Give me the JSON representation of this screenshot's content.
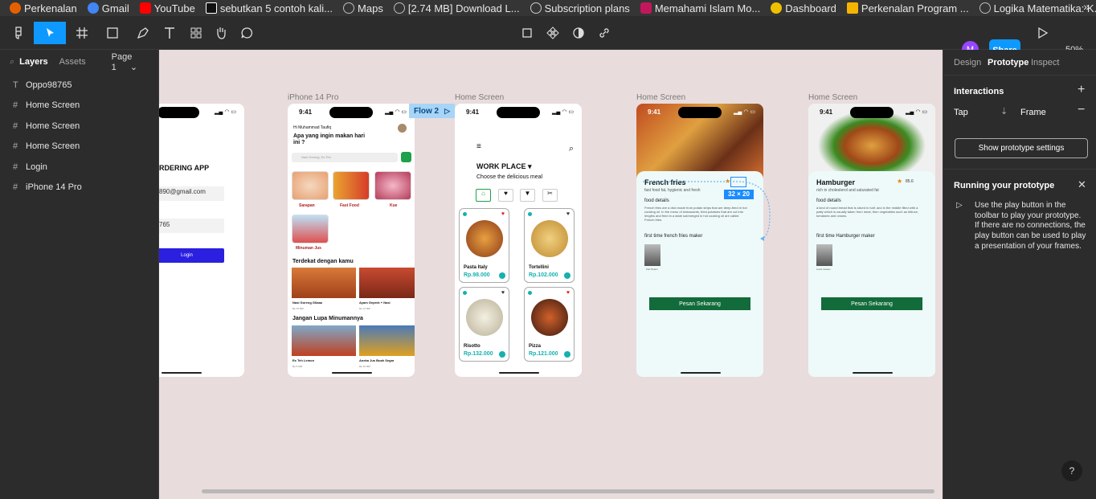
{
  "bookmarks": [
    {
      "label": "Perkenalan",
      "icon": "firefox-icon",
      "color": "#e66000"
    },
    {
      "label": "Gmail",
      "icon": "google-icon",
      "color": "#4285f4"
    },
    {
      "label": "YouTube",
      "icon": "youtube-icon",
      "color": "#ff0000"
    },
    {
      "label": "sebutkan 5 contoh kali...",
      "icon": "brainly-icon",
      "color": "#111111"
    },
    {
      "label": "Maps",
      "icon": "globe-icon",
      "color": "#888888"
    },
    {
      "label": "[2.74 MB] Download L...",
      "icon": "globe-icon",
      "color": "#888888"
    },
    {
      "label": "Subscription plans",
      "icon": "openai-icon",
      "color": "#cccccc"
    },
    {
      "label": "Memahami Islam Mo...",
      "icon": "app-icon",
      "color": "#c2185b"
    },
    {
      "label": "Dashboard",
      "icon": "dashboard-icon",
      "color": "#f0c000"
    },
    {
      "label": "Perkenalan Program ...",
      "icon": "slides-icon",
      "color": "#f5b400"
    },
    {
      "label": "Logika Matematika: K...",
      "icon": "globe-icon",
      "color": "#888888"
    }
  ],
  "toolbar": {
    "avatar_initial": "M",
    "share_label": "Share",
    "zoom": "50%"
  },
  "left": {
    "tabs": {
      "layers": "Layers",
      "assets": "Assets",
      "page": "Page 1"
    },
    "layers": [
      {
        "label": "Oppo98765",
        "icon": "T"
      },
      {
        "label": "Home Screen",
        "icon": "#"
      },
      {
        "label": "Home Screen",
        "icon": "#"
      },
      {
        "label": "Home Screen",
        "icon": "#"
      },
      {
        "label": "Login",
        "icon": "#"
      },
      {
        "label": "iPhone 14 Pro",
        "icon": "#"
      }
    ]
  },
  "canvas": {
    "frame_labels": [
      "iPhone 14 Pro",
      "Home Screen",
      "Home Screen",
      "Home Screen"
    ],
    "flow_label": "Flow 2",
    "selection_size": "32 × 20",
    "login": {
      "title": "RDERING APP",
      "email": "890@gmail.com",
      "password": "765",
      "button": "Login"
    },
    "home1": {
      "time": "9:41",
      "greeting": "Hi Muhammad Taufiq",
      "question": "Apa yang ingin makan hari ini ?",
      "search_placeholder": "Nasi Goreng, Es Teh",
      "categories": [
        "Sarapan",
        "Fast Food",
        "Kue",
        "Minuman Jus"
      ],
      "near_title": "Terdekat dengan kamu",
      "near_items": [
        "Nasi Goreng Gilaaa",
        "Ayam Geprek + Nasi"
      ],
      "near_prices": [
        "Rp 15.000",
        "Rp 12.000"
      ],
      "drink_title": "Jangan Lupa Minumannya",
      "drink_items": [
        "Es Teh Lemon",
        "Aneka Jus Buah Segar"
      ],
      "drink_prices": [
        "Rp 5.000",
        "Rp 10.000"
      ]
    },
    "home2": {
      "time": "9:41",
      "title": "WORK PLACE",
      "subtitle": "Choose the delicious meal",
      "cards": [
        {
          "name": "Pasta Italy",
          "price": "Rp.98.000"
        },
        {
          "name": "Tortellini",
          "price": "Rp.102.000"
        },
        {
          "name": "Risotto",
          "price": "Rp.132.000"
        },
        {
          "name": "Pizza",
          "price": "Rp.121.000"
        }
      ]
    },
    "detail1": {
      "time": "9:41",
      "title": "French fries",
      "subtitle": "fast food fat, hygienic and fresh",
      "details_h": "food details",
      "details_text": "French fries are a dish made from potato strips that are deep-fried in hot cooking oil. In the menu of restaurants, fried potatoes that are cut into lengths and fried in a state submerged in hot cooking oil are called French fries.",
      "maker_h": "first time french fries maker",
      "maker_name": "Karl Peters",
      "button": "Pesan Sekarang"
    },
    "detail2": {
      "time": "9:41",
      "title": "Hamburger",
      "rating": "85.6",
      "subtitle": "rich in cholesterol and saturated fat",
      "details_h": "food details",
      "details_text": "a kind of round bread that is sliced in half, and in the middle filled with a patty which is usually taken from meat, then vegetables such as lettuce, tomatoes and onions.",
      "maker_h": "first time Hamburger maker",
      "maker_name": "Louis Lassen",
      "button": "Pesan Sekarang"
    }
  },
  "right": {
    "tabs": {
      "design": "Design",
      "prototype": "Prototype",
      "inspect": "Inspect"
    },
    "interactions_h": "Interactions",
    "trigger": "Tap",
    "action": "Frame",
    "show_settings": "Show prototype settings",
    "running_h": "Running your prototype",
    "running_text": "Use the play button in the toolbar to play your prototype. If there are no connections, the play button can be used to play a presentation of your frames.",
    "help": "?"
  }
}
